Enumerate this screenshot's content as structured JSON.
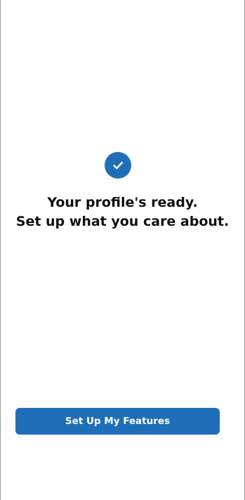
{
  "status": {
    "icon": "check-circle-icon",
    "accent_color": "#1f6fb8"
  },
  "headline": {
    "line1": "Your profile's ready.",
    "line2": "Set up what you care about."
  },
  "actions": {
    "primary_label": "Set Up My Features"
  }
}
